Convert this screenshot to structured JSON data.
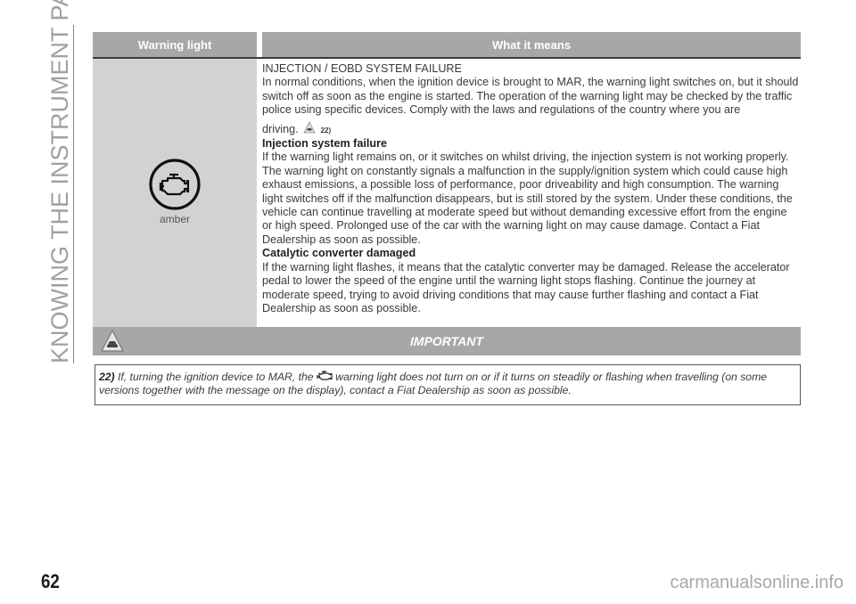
{
  "section_title": "KNOWING THE INSTRUMENT PANEL",
  "page_number": "62",
  "watermark": "carmanualsonline.info",
  "table": {
    "headers": [
      "Warning light",
      "What it means"
    ],
    "rows": [
      {
        "icon": "engine-check-icon",
        "color_label": "amber",
        "title": "INJECTION / EOBD SYSTEM FAILURE",
        "intro": "In normal conditions, when the ignition device is brought to MAR, the warning light switches on, but it should switch off as soon as the engine is started. The operation of the warning light may be checked by the traffic police using specific devices. Comply with the laws and regulations of the country where you are",
        "intro_end": "driving.",
        "ref": "22)",
        "sections": [
          {
            "heading": "Injection system failure",
            "body": "If the warning light remains on, or it switches on whilst driving, the injection system is not working properly. The warning light on constantly signals a malfunction in the supply/ignition system which could cause high exhaust emissions, a possible loss of performance, poor driveability and high consumption. The warning light switches off if the malfunction disappears, but is still stored by the system. Under these conditions, the vehicle can continue travelling at moderate speed but without demanding excessive effort from the engine or high speed. Prolonged use of the car with the warning light on may cause damage. Contact a Fiat Dealership as soon as possible."
          },
          {
            "heading": "Catalytic converter damaged",
            "body": "If the warning light flashes, it means that the catalytic converter may be damaged. Release the accelerator pedal to lower the speed of the engine until the warning light stops flashing. Continue the journey at moderate speed, trying to avoid driving conditions that may cause further flashing and contact a Fiat Dealership as soon as possible."
          }
        ]
      }
    ]
  },
  "important": {
    "title": "IMPORTANT",
    "icon": "car-warning-icon",
    "note_number": "22)",
    "note_before": "If, turning the ignition device to MAR, the",
    "note_after": "warning light does not turn on or if it turns on steadily or flashing when travelling (on some versions together with the message on the display), contact a Fiat Dealership as soon as possible."
  },
  "colors": {
    "header_bg": "#a6a7a9",
    "light_cell_bg": "#d1d2d4",
    "rule": "#3a3a3a"
  }
}
